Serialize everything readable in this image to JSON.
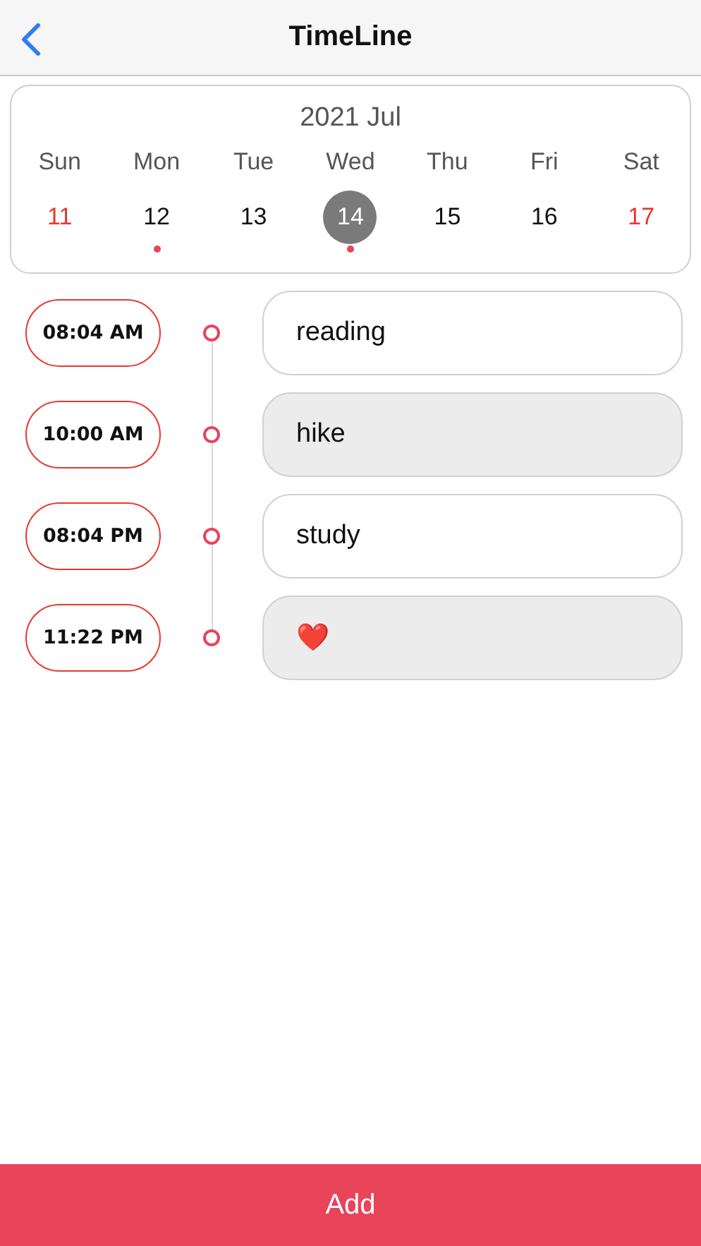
{
  "nav": {
    "title": "TimeLine"
  },
  "calendar": {
    "month": "2021 Jul",
    "weekdays": [
      "Sun",
      "Mon",
      "Tue",
      "Wed",
      "Thu",
      "Fri",
      "Sat"
    ],
    "days": [
      {
        "label": "11",
        "color": "#e8392f",
        "selected": false,
        "marked": false
      },
      {
        "label": "12",
        "color": "#111111",
        "selected": false,
        "marked": true
      },
      {
        "label": "13",
        "color": "#111111",
        "selected": false,
        "marked": false
      },
      {
        "label": "14",
        "color": "#ffffff",
        "selected": true,
        "marked": true
      },
      {
        "label": "15",
        "color": "#111111",
        "selected": false,
        "marked": false
      },
      {
        "label": "16",
        "color": "#111111",
        "selected": false,
        "marked": false
      },
      {
        "label": "17",
        "color": "#e8392f",
        "selected": false,
        "marked": false
      }
    ]
  },
  "entries": [
    {
      "time": "08:04 AM",
      "text": "reading",
      "shaded": false
    },
    {
      "time": "10:00 AM",
      "text": "hike",
      "shaded": true
    },
    {
      "time": "08:04 PM",
      "text": "study",
      "shaded": false
    },
    {
      "time": "11:22 PM",
      "text": "❤️",
      "shaded": true
    }
  ],
  "add_button": "Add"
}
